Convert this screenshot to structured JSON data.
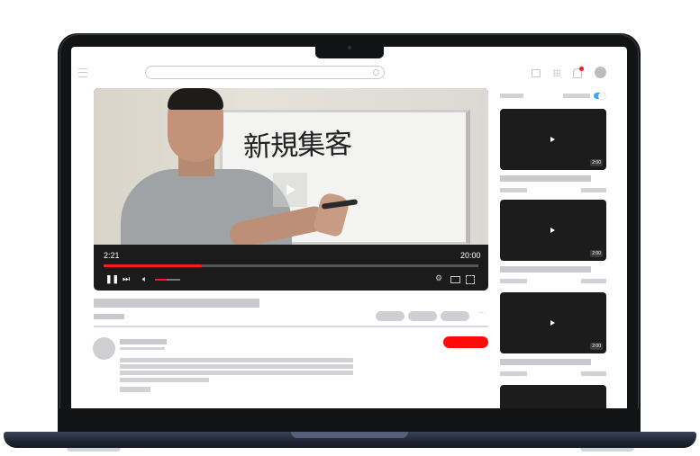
{
  "video": {
    "current_time": "2:21",
    "total_time": "20:00",
    "whiteboard_text": "新規集客",
    "progress_fraction": 0.26,
    "volume_fraction": 0.45
  },
  "sidebar": {
    "thumbnails": [
      {
        "duration": "2:00"
      },
      {
        "duration": "2:00"
      },
      {
        "duration": "2:00"
      }
    ]
  },
  "colors": {
    "accent": "#ff1a1a",
    "toggle": "#3ea6ff",
    "placeholder": "#c9c9ce",
    "laptop": "#121315"
  },
  "icons": [
    "menu-icon",
    "search-icon",
    "camera-icon",
    "apps-icon",
    "bell-icon",
    "play-icon",
    "pause-icon",
    "next-icon",
    "volume-icon",
    "settings-icon",
    "miniplayer-icon",
    "fullscreen-icon",
    "more-icon"
  ]
}
